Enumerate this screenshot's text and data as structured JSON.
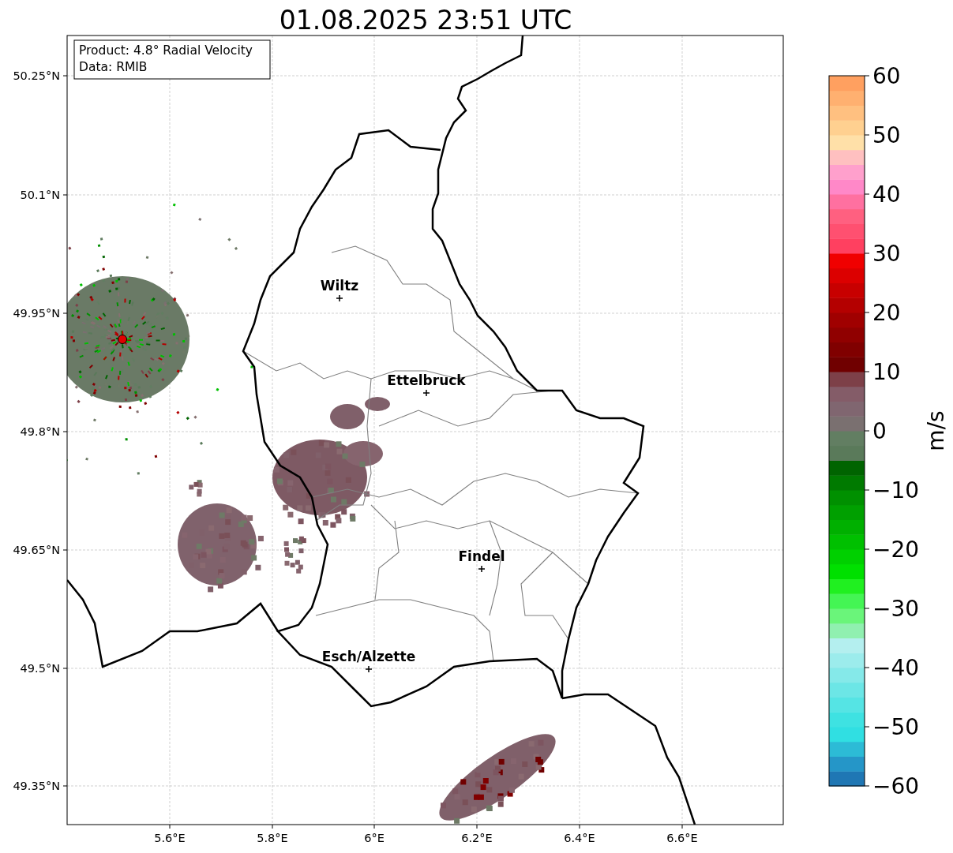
{
  "title": "01.08.2025 23:51 UTC",
  "legend": [
    "Product: 4.8° Radial Velocity",
    "Data: RMIB"
  ],
  "cities": [
    {
      "name": "Wiltz"
    },
    {
      "name": "Ettelbruck"
    },
    {
      "name": "Findel"
    },
    {
      "name": "Esch/Alzette"
    }
  ],
  "x_ticks": [
    "5.6°E",
    "5.8°E",
    "6°E",
    "6.2°E",
    "6.4°E",
    "6.6°E"
  ],
  "y_ticks": [
    "50.25°N",
    "50.1°N",
    "49.95°N",
    "49.8°N",
    "49.65°N",
    "49.5°N",
    "49.35°N"
  ],
  "colorbar": {
    "label": "m/s",
    "ticks": [
      "60",
      "50",
      "40",
      "30",
      "20",
      "10",
      "0",
      "−10",
      "−20",
      "−30",
      "−40",
      "−50",
      "−60"
    ]
  }
}
